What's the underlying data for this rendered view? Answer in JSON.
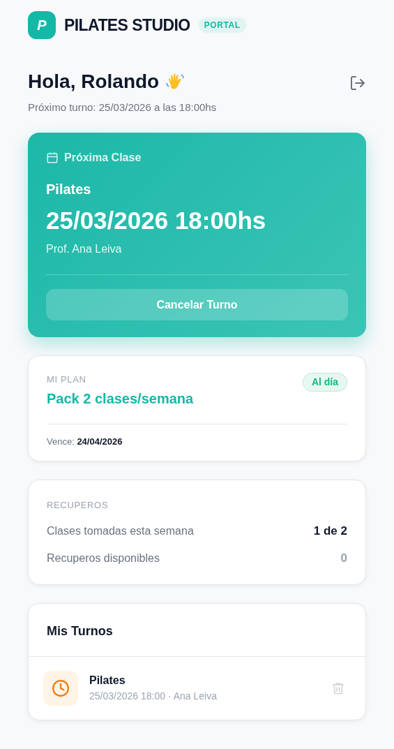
{
  "brand": {
    "logo_letter": "P",
    "name": "PILATES STUDIO",
    "badge": "PORTAL"
  },
  "greeting": {
    "title": "Hola, Rolando",
    "subtitle": "Próximo turno: 25/03/2026 a las 18:00hs"
  },
  "next_class": {
    "label": "Próxima Clase",
    "name": "Pilates",
    "datetime": "25/03/2026 18:00hs",
    "teacher": "Prof. Ana Leiva",
    "button": "Cancelar Turno"
  },
  "plan": {
    "label": "MI PLAN",
    "name": "Pack 2 clases/semana",
    "status": "Al día",
    "expiry": "Vence: **24/04/2026**"
  },
  "recoveries": {
    "label": "RECUPEROS",
    "rows": [
      {
        "label": "Clases tomadas esta semana",
        "value": "1 de 2",
        "highlight": true
      },
      {
        "label": "Recuperos disponibles",
        "value": "0",
        "highlight": false
      }
    ]
  },
  "appointments": {
    "title": "Mis Turnos",
    "items": [
      {
        "name": "Pilates",
        "detail": "25/03/2026 18:00 · Ana Leiva"
      }
    ]
  }
}
